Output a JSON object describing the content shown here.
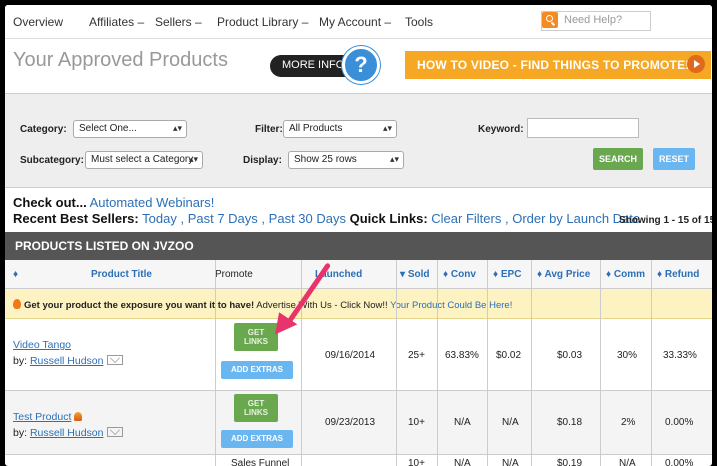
{
  "nav": {
    "items": [
      "Overview",
      "Affiliates –",
      "Sellers –",
      "Product Library –",
      "My Account –",
      "Tools"
    ],
    "help_placeholder": "Need Help?"
  },
  "header": {
    "title": "Your Approved Products",
    "more_info": "MORE INFO",
    "question": "?",
    "howto": "HOW TO VIDEO - FIND THINGS TO PROMOTE!"
  },
  "filters": {
    "category_label": "Category:",
    "category_value": "Select One...",
    "subcategory_label": "Subcategory:",
    "subcategory_value": "Must select a Category",
    "filter_label": "Filter:",
    "filter_value": "All Products",
    "display_label": "Display:",
    "display_value": "Show 25 rows",
    "keyword_label": "Keyword:",
    "search": "SEARCH",
    "reset": "RESET"
  },
  "links": {
    "checkout_label": "Check out...",
    "checkout_link": "Automated Webinars!",
    "recent_label": "Recent Best Sellers:",
    "recent_today": "Today",
    "recent_7": "Past 7 Days",
    "recent_30": "Past 30 Days",
    "quick_label": "Quick Links:",
    "clear": "Clear Filters",
    "order": "Order by Launch Date",
    "showing": "Showing 1 - 15 of 15"
  },
  "table": {
    "title": "PRODUCTS LISTED ON JVZOO",
    "headers": {
      "title": "Product Title",
      "promote": "Promote",
      "launched": "Launched",
      "sold": "Sold",
      "conv": "Conv",
      "epc": "EPC",
      "avg": "Avg Price",
      "comm": "Comm",
      "refund": "Refund"
    },
    "promo": {
      "bold": "Get your product the exposure you want it to have!",
      "text": " Advertise With Us - Click Now!! ",
      "link": "Your Product Could Be Here!"
    },
    "rows": [
      {
        "name": "Video Tango",
        "by": "by:",
        "seller": "Russell Hudson",
        "launched": "09/16/2014",
        "sold": "25+",
        "conv": "63.83%",
        "epc": "$0.02",
        "avg": "$0.03",
        "comm": "30%",
        "refund": "33.33%"
      },
      {
        "name": "Test Product",
        "by": "by:",
        "seller": "Russell Hudson",
        "launched": "09/23/2013",
        "sold": "10+",
        "conv": "N/A",
        "epc": "N/A",
        "avg": "$0.18",
        "comm": "2%",
        "refund": "0.00%"
      },
      {
        "promote": "Sales Funnel",
        "sold": "10+",
        "conv": "N/A",
        "epc": "N/A",
        "avg": "$0.19",
        "comm": "N/A",
        "refund": "0.00%"
      }
    ],
    "get_links": "GET LINKS",
    "add_extras": "ADD EXTRAS"
  },
  "colors": {
    "accent_orange": "#f6a723",
    "link_blue": "#2c6fb7",
    "button_green": "#6aa84f",
    "arrow_pink": "#e8336b"
  }
}
